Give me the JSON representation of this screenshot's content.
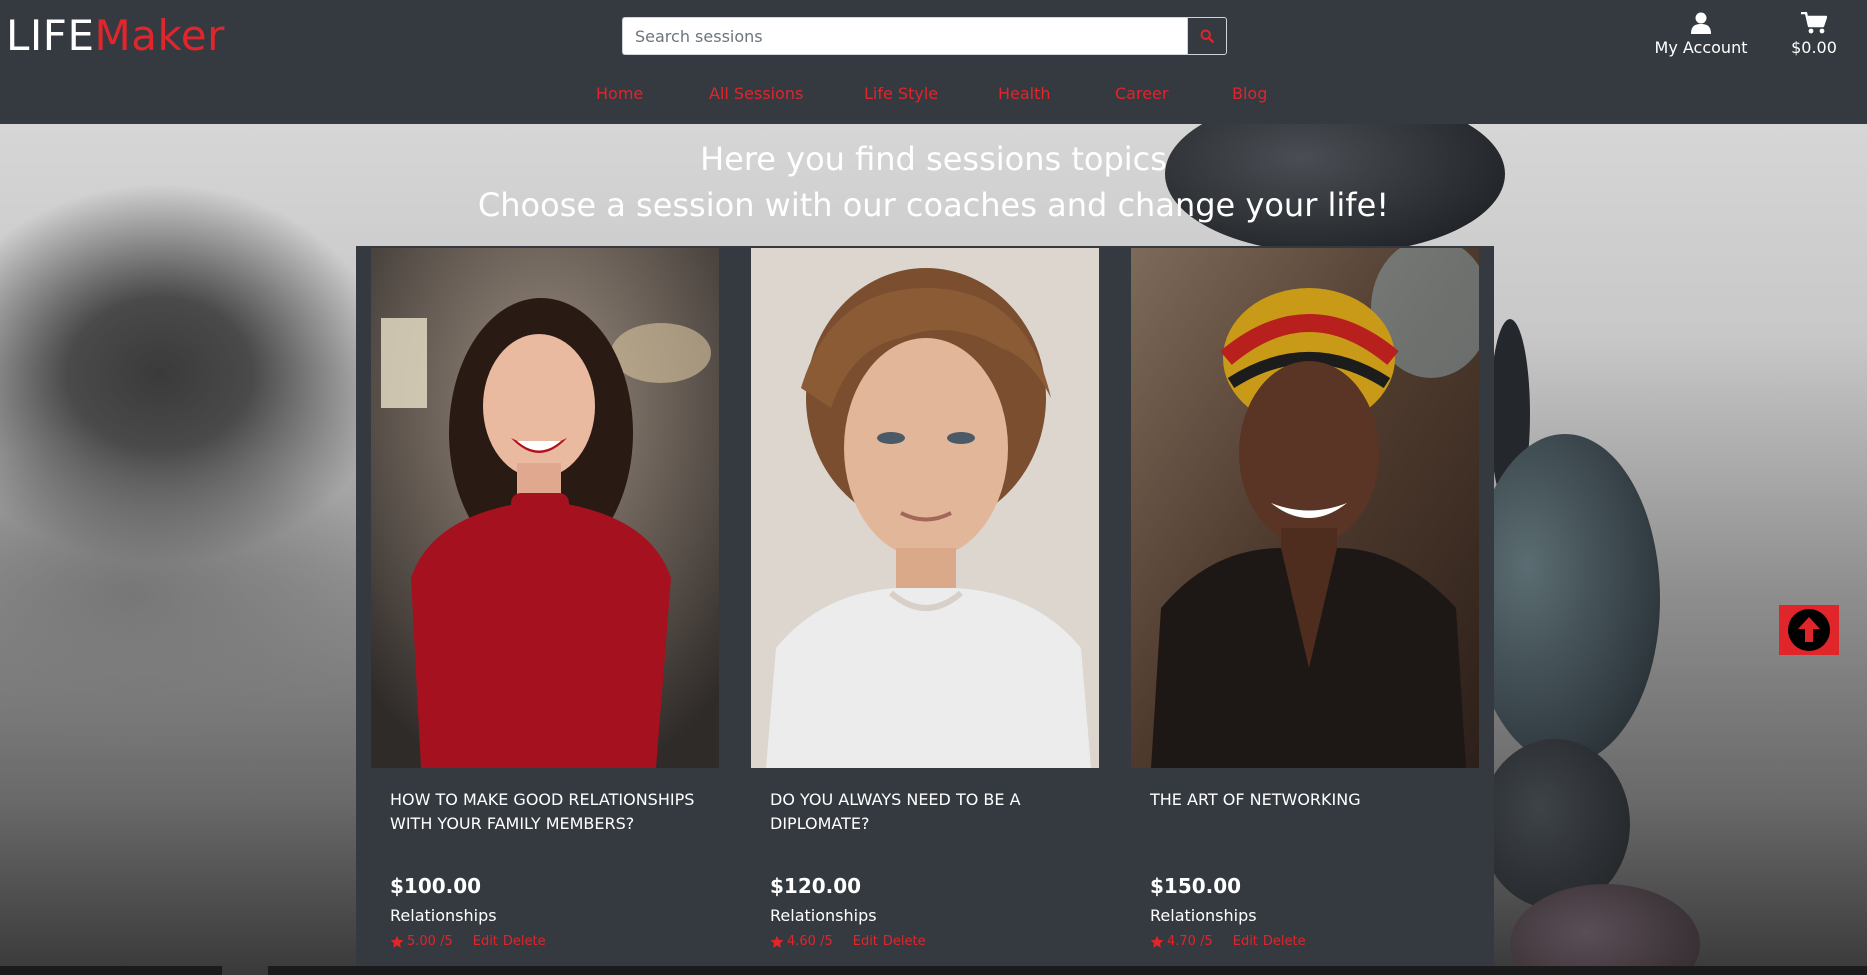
{
  "brand": {
    "part1": "LIFE",
    "part2": "Maker"
  },
  "search": {
    "placeholder": "Search sessions",
    "icon": "search-icon"
  },
  "account": {
    "label": "My Account",
    "icon": "user-icon"
  },
  "cart": {
    "total": "$0.00",
    "icon": "cart-icon"
  },
  "nav": [
    "Home",
    "All Sessions",
    "Life Style",
    "Health",
    "Career",
    "Blog"
  ],
  "hero": {
    "line1": "Here you find sessions topics",
    "line2": "Choose a session with our coaches and change your life!"
  },
  "sessions": [
    {
      "title": "How to make good relationships with your family members?",
      "price": "$100.00",
      "category": "Relationships",
      "rating": "5.00 /5",
      "edit": "Edit",
      "delete": "Delete"
    },
    {
      "title": "Do you always need to be a diplomate?",
      "price": "$120.00",
      "category": "Relationships",
      "rating": "4.60 /5",
      "edit": "Edit",
      "delete": "Delete"
    },
    {
      "title": "The art of networking",
      "price": "$150.00",
      "category": "Relationships",
      "rating": "4.70 /5",
      "edit": "Edit",
      "delete": "Delete"
    }
  ],
  "colors": {
    "accent": "#e0252b",
    "header_bg": "#343a40",
    "text_light": "#ffffff"
  }
}
